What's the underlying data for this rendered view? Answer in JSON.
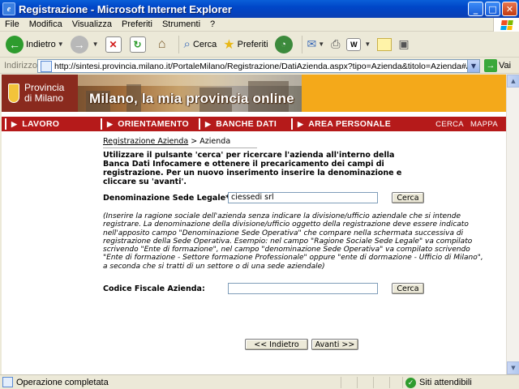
{
  "window": {
    "title": "Registrazione - Microsoft Internet Explorer",
    "controls": {
      "minimize": "_",
      "maximize": "□",
      "close": "✕"
    }
  },
  "menu": [
    "File",
    "Modifica",
    "Visualizza",
    "Preferiti",
    "Strumenti",
    "?"
  ],
  "toolbar": {
    "back_label": "Indietro",
    "search_label": "Cerca",
    "favorites_label": "Preferiti"
  },
  "address": {
    "label": "Indirizzo",
    "url": "http://sintesi.provincia.milano.it/PortaleMilano/Registrazione/DatiAzienda.aspx?tipo=Azienda&titolo=Azienda#Anchor1",
    "go_label": "Vai"
  },
  "banner": {
    "logo_line1": "Provincia",
    "logo_line2": "di Milano",
    "slogan": "Milano, la mia provincia online"
  },
  "nav": {
    "items": [
      "LAVORO",
      "ORIENTAMENTO",
      "BANCHE DATI",
      "AREA PERSONALE"
    ],
    "right": [
      "CERCA",
      "MAPPA"
    ]
  },
  "breadcrumb": {
    "link": "Registrazione Azienda",
    "separator": ">",
    "current": "Azienda"
  },
  "intro": "Utilizzare il pulsante 'cerca' per ricercare l'azienda all'interno della Banca Dati Infocamere e ottenere il precaricamento dei campi di registrazione. Per un nuovo inserimento inserire la denominazione e cliccare su 'avanti'.",
  "form": {
    "denominazione_label": "Denominazione Sede Legale*:",
    "denominazione_value": "ciessedi srl",
    "codice_fiscale_label": "Codice Fiscale Azienda:",
    "codice_fiscale_value": "",
    "search_button": "Cerca"
  },
  "note": "(Inserire la ragione sociale dell'azienda senza indicare la divisione/ufficio aziendale che si intende registrare. La denominazione della divisione/ufficio oggetto della registrazione deve essere indicato nell'apposito campo \"Denominazione Sede Operativa\" che compare nella schermata successiva di registrazione della Sede Operativa. Esempio: nel campo \"Ragione Sociale Sede Legale\" va compilato scrivendo \"Ente di formazione\", nel campo \"denominazione Sede Operativa\" va compilato scrivendo \"Ente di formazione - Settore formazione Professionale\" oppure \"ente di dormazione - Ufficio di Milano\", a seconda che si tratti di un settore o di una sede aziendale)",
  "buttons": {
    "back": "<< Indietro",
    "next": "Avanti >>"
  },
  "status": {
    "text": "Operazione completata",
    "zone": "Siti attendibili"
  },
  "colors": {
    "banner_orange": "#f4a91a",
    "nav_red": "#b51a1a",
    "title_blue": "#0a5fd8"
  }
}
